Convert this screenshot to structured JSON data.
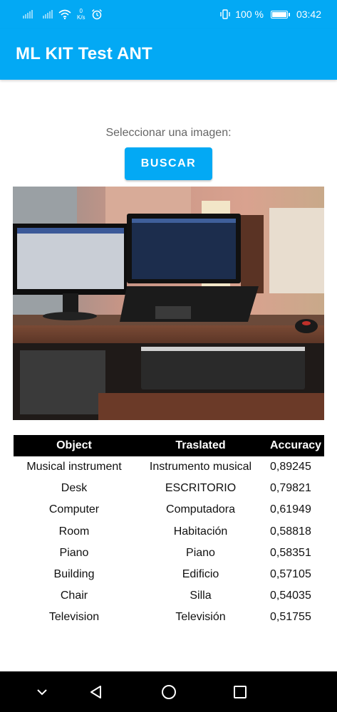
{
  "status_bar": {
    "net_speed_value": "0",
    "net_speed_unit": "K/s",
    "battery": "100 %",
    "time": "03:42",
    "icons": [
      "signal-icon",
      "signal-icon",
      "wifi-icon",
      "alarm-icon",
      "vibrate-icon",
      "battery-icon"
    ]
  },
  "app_bar": {
    "title": "ML KIT Test ANT"
  },
  "main": {
    "select_label": "Seleccionar una imagen:",
    "search_button": "BUSCAR"
  },
  "results": {
    "headers": [
      "Object",
      "Traslated",
      "Accuracy"
    ],
    "rows": [
      [
        "Musical instrument",
        "Instrumento musical",
        "0,89245"
      ],
      [
        "Desk",
        "ESCRITORIO",
        "0,79821"
      ],
      [
        "Computer",
        "Computadora",
        "0,61949"
      ],
      [
        "Room",
        "Habitación",
        "0,58818"
      ],
      [
        "Piano",
        "Piano",
        "0,58351"
      ],
      [
        "Building",
        "Edificio",
        "0,57105"
      ],
      [
        "Chair",
        "Silla",
        "0,54035"
      ],
      [
        "Television",
        "Televisión",
        "0,51755"
      ]
    ]
  },
  "nav_bar": {
    "buttons": [
      "collapse-icon",
      "back-icon",
      "home-icon",
      "recents-icon"
    ]
  },
  "colors": {
    "primary": "#03a9f4",
    "table_header": "#000000",
    "nav_bar": "#000000"
  }
}
